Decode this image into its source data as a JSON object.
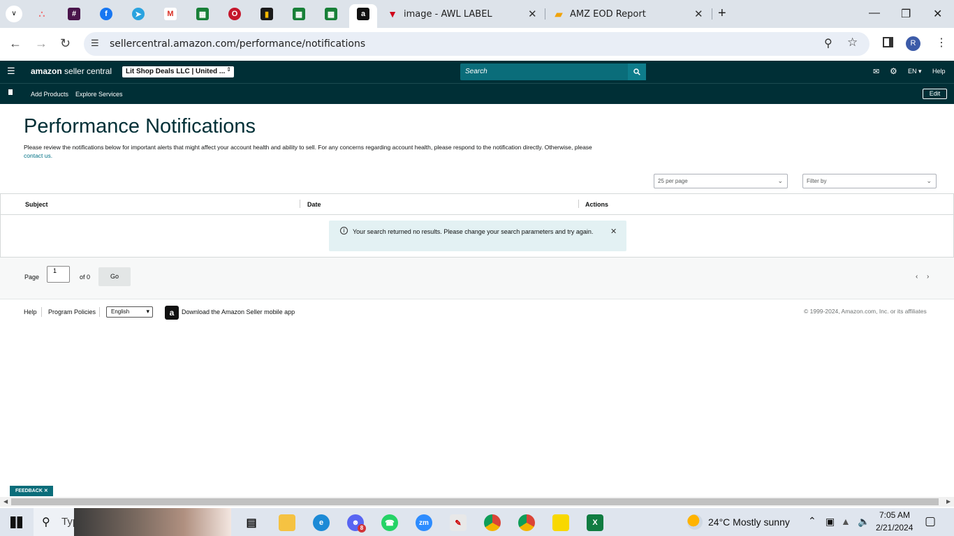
{
  "browser": {
    "tabs": [
      {
        "title": "image - AWL LABEL"
      },
      {
        "title": "AMZ EOD Report"
      }
    ],
    "url": "sellercentral.amazon.com/performance/notifications",
    "profile_initial": "R"
  },
  "header": {
    "logo_brand": "amazon",
    "logo_product": "seller central",
    "account_selector": "Lit Shop Deals LLC | United ...",
    "search_placeholder": "Search",
    "language": "EN",
    "help": "Help",
    "nav_items": [
      "Add Products",
      "Explore Services"
    ],
    "edit_label": "Edit"
  },
  "page": {
    "title": "Performance Notifications",
    "description": "Please review the notifications below for important alerts that might affect your account health and ability to sell. For any concerns regarding account health, please respond to the notification directly. Otherwise, please",
    "contact_link": "contact us.",
    "per_page": "25 per page",
    "filter_placeholder": "Filter by",
    "columns": [
      "Subject",
      "Date",
      "Actions"
    ],
    "alert_message": "Your search returned no results. Please change your search parameters and try again.",
    "pager": {
      "page_label": "Page",
      "page_value": "1",
      "of_label": "of 0",
      "go_label": "Go"
    }
  },
  "footer": {
    "help": "Help",
    "program_policies": "Program Policies",
    "language_select": "English",
    "mobile_app": "Download the Amazon Seller mobile app",
    "copyright": "© 1999-2024, Amazon.com, Inc. or its affiliates"
  },
  "feedback_label": "FEEDBACK",
  "taskbar": {
    "search_placeholder": "Typ",
    "weather": "24°C  Mostly sunny",
    "time": "7:05 AM",
    "date": "2/21/2024",
    "discord_badge": "8"
  },
  "colors": {
    "header_bg": "#002f36",
    "accent": "#0a6d7a",
    "alert_bg": "#e3f1f3"
  }
}
